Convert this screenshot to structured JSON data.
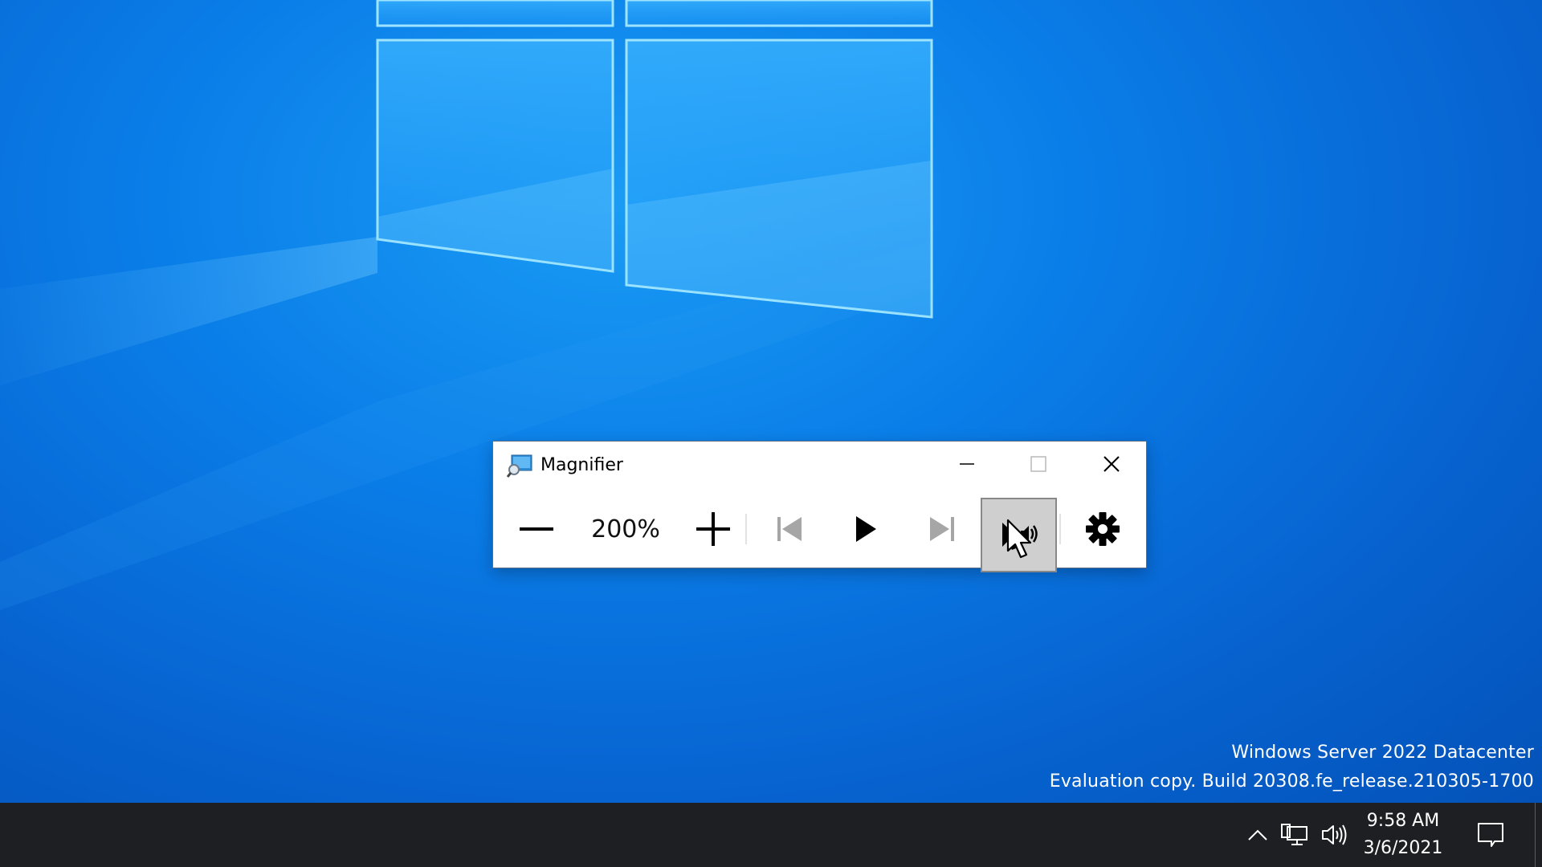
{
  "desktop": {
    "watermark": {
      "line1": "Windows Server 2022 Datacenter",
      "line2": "Evaluation copy. Build 20308.fe_release.210305-1700"
    }
  },
  "magnifier": {
    "title": "Magnifier",
    "app_icon": "magnifier-app-icon",
    "caption_buttons": {
      "minimize_icon": "minimize-icon",
      "maximize_icon": "maximize-icon",
      "close_icon": "close-icon"
    },
    "toolbar": {
      "zoom_level": "200%",
      "zoom_out_icon": "minus-icon",
      "zoom_in_icon": "plus-icon",
      "previous_icon": "skip-previous-icon",
      "play_icon": "play-icon",
      "next_icon": "skip-next-icon",
      "read_from_here_icon": "read-from-here-icon",
      "settings_icon": "gear-icon",
      "pressed_button": "read-from-here"
    }
  },
  "taskbar": {
    "time": "9:58 AM",
    "date": "3/6/2021",
    "tray_icons": [
      "chevron-up-icon",
      "network-icon",
      "volume-icon",
      "notifications-icon"
    ]
  },
  "colors": {
    "desktop_blue": "#0a7ee8",
    "taskbar": "#1d1f22",
    "pressed_button_bg": "#cfcfcf",
    "disabled_icon": "#a6a6a6"
  }
}
